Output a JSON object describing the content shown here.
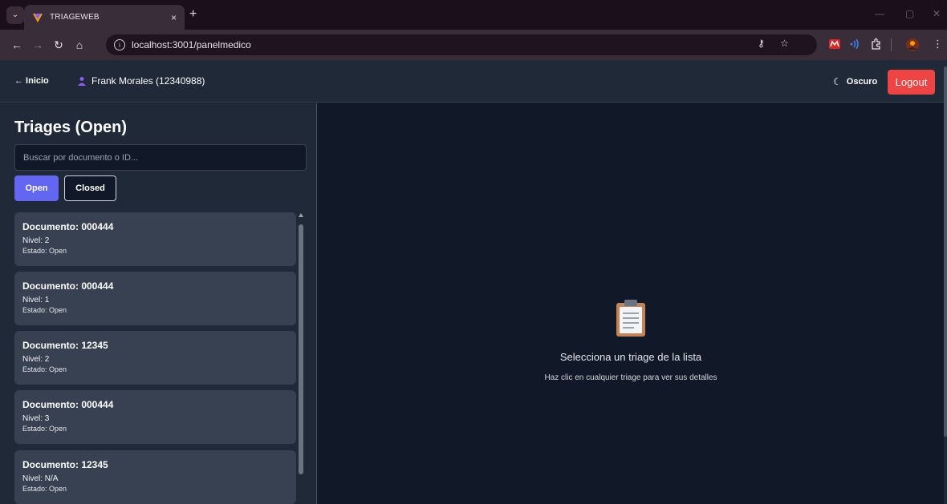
{
  "browser": {
    "tab_title": "TRIAGEWEB",
    "tab_close": "×",
    "new_tab": "+",
    "url": "localhost:3001/panelmedico",
    "info_icon": "i",
    "min": "—",
    "restore": "▢",
    "close": "✕"
  },
  "header": {
    "home_label": "← Inicio",
    "user_label": "Frank Morales (12340988)",
    "theme_label": "Oscuro",
    "logout_label": "Logout"
  },
  "sidebar": {
    "title": "Triages (Open)",
    "search_placeholder": "Buscar por documento o ID...",
    "filters": {
      "open_label": "Open",
      "closed_label": "Closed"
    },
    "cards": [
      {
        "title": "Documento: 000444",
        "level": "Nivel: 2",
        "status": "Estado: Open"
      },
      {
        "title": "Documento: 000444",
        "level": "Nivel: 1",
        "status": "Estado: Open"
      },
      {
        "title": "Documento: 12345",
        "level": "Nivel: 2",
        "status": "Estado: Open"
      },
      {
        "title": "Documento: 000444",
        "level": "Nivel: 3",
        "status": "Estado: Open"
      },
      {
        "title": "Documento: 12345",
        "level": "Nivel: N/A",
        "status": "Estado: Open"
      }
    ]
  },
  "main": {
    "empty_title": "Selecciona un triage de la lista",
    "empty_subtitle": "Haz clic en cualquier triage para ver sus detalles"
  },
  "colors": {
    "accent": "#6366f1",
    "logout": "#ef4444",
    "panel": "#1f2937",
    "background": "#111827",
    "card": "#374151"
  }
}
